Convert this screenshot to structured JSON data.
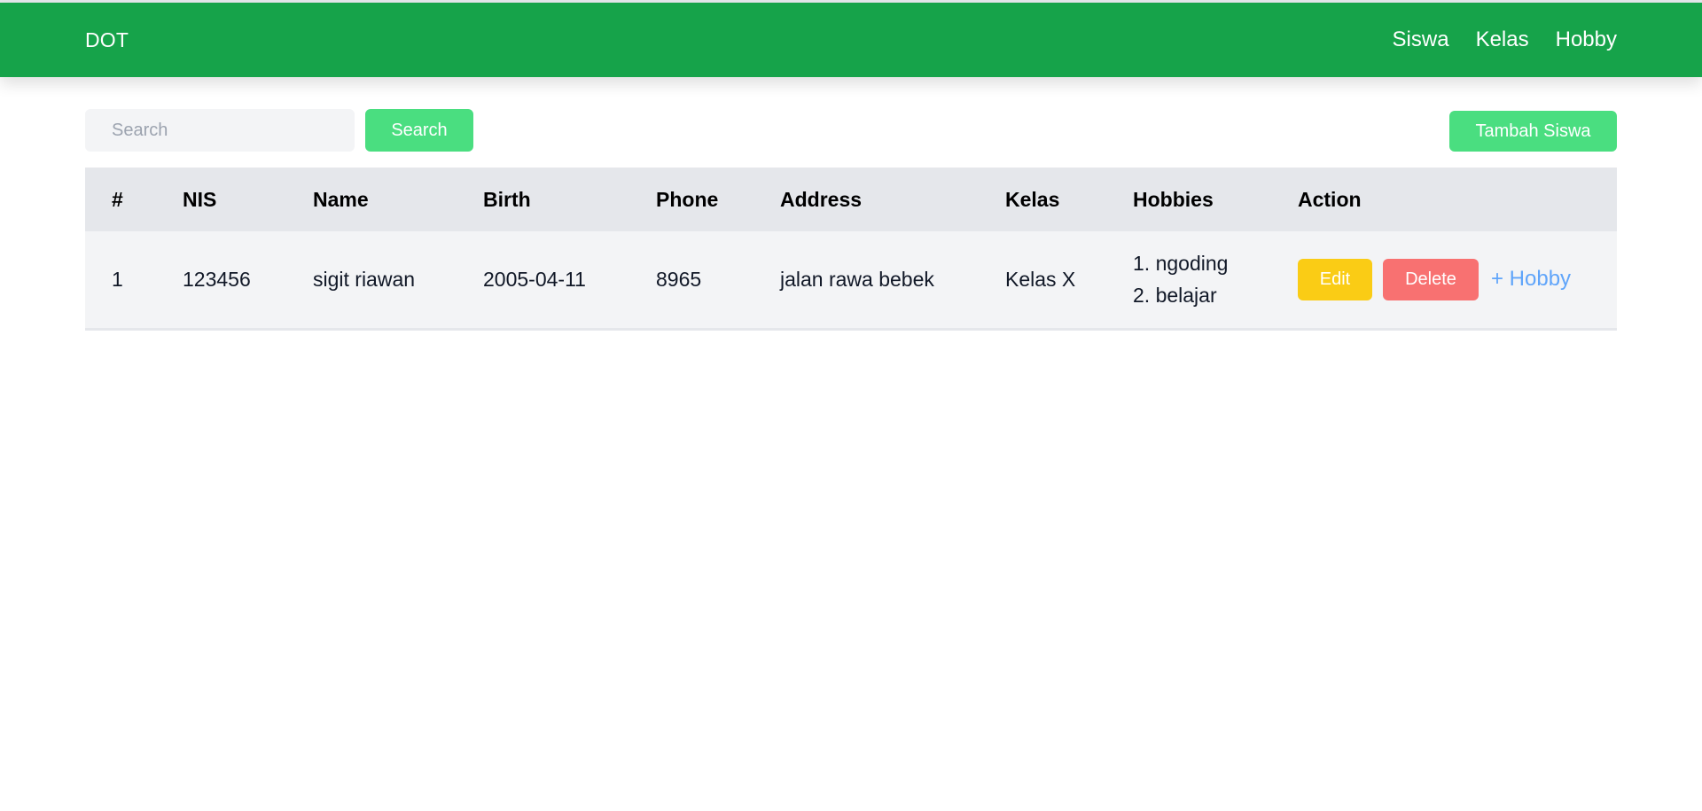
{
  "navbar": {
    "brand": "DOT",
    "links": [
      "Siswa",
      "Kelas",
      "Hobby"
    ],
    "color": "#16a34a"
  },
  "toolbar": {
    "search_placeholder": "Search",
    "search_value": "",
    "search_label": "Search",
    "add_label": "Tambah Siswa",
    "accent": "#4ade80"
  },
  "table": {
    "headers": [
      "#",
      "NIS",
      "Name",
      "Birth",
      "Phone",
      "Address",
      "Kelas",
      "Hobbies",
      "Action"
    ],
    "rows": [
      {
        "no": "1",
        "nis": "123456",
        "name": "sigit riawan",
        "birth": "2005-04-11",
        "phone": "8965",
        "address": "jalan rawa bebek",
        "kelas": "Kelas X",
        "hobbies": [
          "1. ngoding",
          "2. belajar"
        ],
        "edit_label": "Edit",
        "delete_label": "Delete",
        "add_hobby_label": "+ Hobby"
      }
    ]
  },
  "colors": {
    "edit": "#facc15",
    "delete": "#f87171",
    "link": "#60a5fa"
  }
}
